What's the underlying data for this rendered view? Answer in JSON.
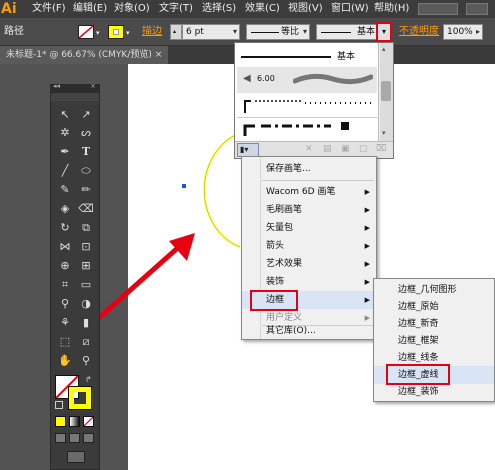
{
  "app": {
    "logo": "Ai"
  },
  "menubar": {
    "items": [
      "文件(F)",
      "编辑(E)",
      "对象(O)",
      "文字(T)",
      "选择(S)",
      "效果(C)",
      "视图(V)",
      "窗口(W)",
      "帮助(H)"
    ]
  },
  "control": {
    "path_label": "路径",
    "stroke_label": "描边",
    "stroke_weight": "6 pt",
    "profile_value": "等比",
    "brush_value": "基本",
    "opacity_label": "不透明度",
    "opacity_value": "100%"
  },
  "document": {
    "tab_title": "未标题-1* @ 66.67% (CMYK/预览)"
  },
  "brush_panel": {
    "header": "基本",
    "row_size": "6.00"
  },
  "library_menu": {
    "items": [
      {
        "label": "保存画笔...",
        "submenu": false
      },
      {
        "label": "Wacom 6D 画笔",
        "submenu": true
      },
      {
        "label": "毛刷画笔",
        "submenu": true
      },
      {
        "label": "矢量包",
        "submenu": true
      },
      {
        "label": "箭头",
        "submenu": true
      },
      {
        "label": "艺术效果",
        "submenu": true
      },
      {
        "label": "装饰",
        "submenu": true
      },
      {
        "label": "边框",
        "submenu": true
      },
      {
        "label": "用户定义",
        "submenu": true
      },
      {
        "label": "其它库(O)...",
        "submenu": false
      }
    ]
  },
  "border_submenu": {
    "items": [
      "边框_几何图形",
      "边框_原始",
      "边框_新奇",
      "边框_框架",
      "边框_线条",
      "边框_虚线",
      "边框_装饰"
    ]
  },
  "colors": {
    "accent": "#e60012",
    "app_orange": "#ff9a00",
    "selection_yellow": "#ffff00"
  }
}
